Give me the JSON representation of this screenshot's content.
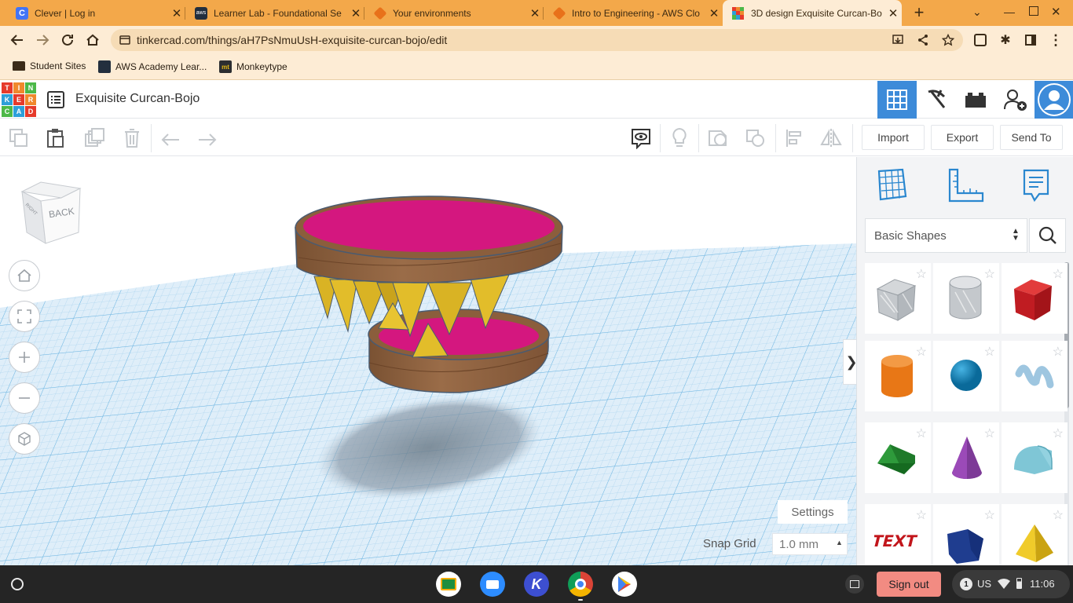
{
  "browser": {
    "tabs": [
      {
        "title": "Clever | Log in",
        "favicon": "clever-icon",
        "color": "#4274f6",
        "letter": "C"
      },
      {
        "title": "Learner Lab - Foundational Se",
        "favicon": "aws-icon",
        "color": "#232f3e",
        "letter": "aws"
      },
      {
        "title": "Your environments",
        "favicon": "cube-icon",
        "color": "#e8711a",
        "letter": ""
      },
      {
        "title": "Intro to Engineering - AWS Clo",
        "favicon": "cube-icon",
        "color": "#e8711a",
        "letter": ""
      },
      {
        "title": "3D design Exquisite Curcan-Bo",
        "favicon": "tinkercad-icon",
        "color": "#ffffff",
        "letter": ""
      }
    ],
    "url": "tinkercad.com/things/aH7PsNmuUsH-exquisite-curcan-bojo/edit",
    "bookmarks": [
      {
        "label": "Student Sites",
        "icon": "folder-icon"
      },
      {
        "label": "AWS Academy Lear...",
        "icon": "aws-icon"
      },
      {
        "label": "Monkeytype",
        "icon": "monkeytype-icon"
      }
    ]
  },
  "tinkercad": {
    "logo_letters": [
      "T",
      "I",
      "N",
      "K",
      "E",
      "R",
      "C",
      "A",
      "D"
    ],
    "logo_colors": [
      "#e63a2b",
      "#f0882c",
      "#4cb848",
      "#2d9fd9",
      "#e63a2b",
      "#f0882c",
      "#4cb848",
      "#2d9fd9",
      "#e63a2b"
    ],
    "design_title": "Exquisite Curcan-Bojo",
    "toolbar": {
      "import_label": "Import",
      "export_label": "Export",
      "send_to_label": "Send To"
    },
    "viewcube_label": "BACK",
    "viewcube_side": "RIGHT",
    "settings_label": "Settings",
    "snap_grid_label": "Snap Grid",
    "snap_grid_value": "1.0 mm",
    "shape_library": "Basic Shapes",
    "shapes": [
      {
        "name": "box-hole",
        "icon": "box-hole-icon"
      },
      {
        "name": "cylinder-hole",
        "icon": "cylinder-hole-icon"
      },
      {
        "name": "box",
        "icon": "box-icon"
      },
      {
        "name": "cylinder",
        "icon": "cylinder-icon"
      },
      {
        "name": "sphere",
        "icon": "sphere-icon"
      },
      {
        "name": "scribble",
        "icon": "scribble-icon"
      },
      {
        "name": "roof",
        "icon": "roof-icon"
      },
      {
        "name": "cone",
        "icon": "cone-icon"
      },
      {
        "name": "round-roof",
        "icon": "round-roof-icon"
      },
      {
        "name": "text",
        "icon": "text-icon"
      },
      {
        "name": "polygon",
        "icon": "polygon-icon"
      },
      {
        "name": "pyramid",
        "icon": "pyramid-icon"
      }
    ],
    "colors": {
      "accent": "#3d8bd9",
      "grid_bg": "#dfeef9",
      "brown": "#8b5e3c",
      "magenta": "#d4177f",
      "teeth": "#e2bd2a"
    }
  },
  "shelf": {
    "signout_label": "Sign out",
    "notification_count": "1",
    "keyboard": "US",
    "time": "11:06"
  }
}
